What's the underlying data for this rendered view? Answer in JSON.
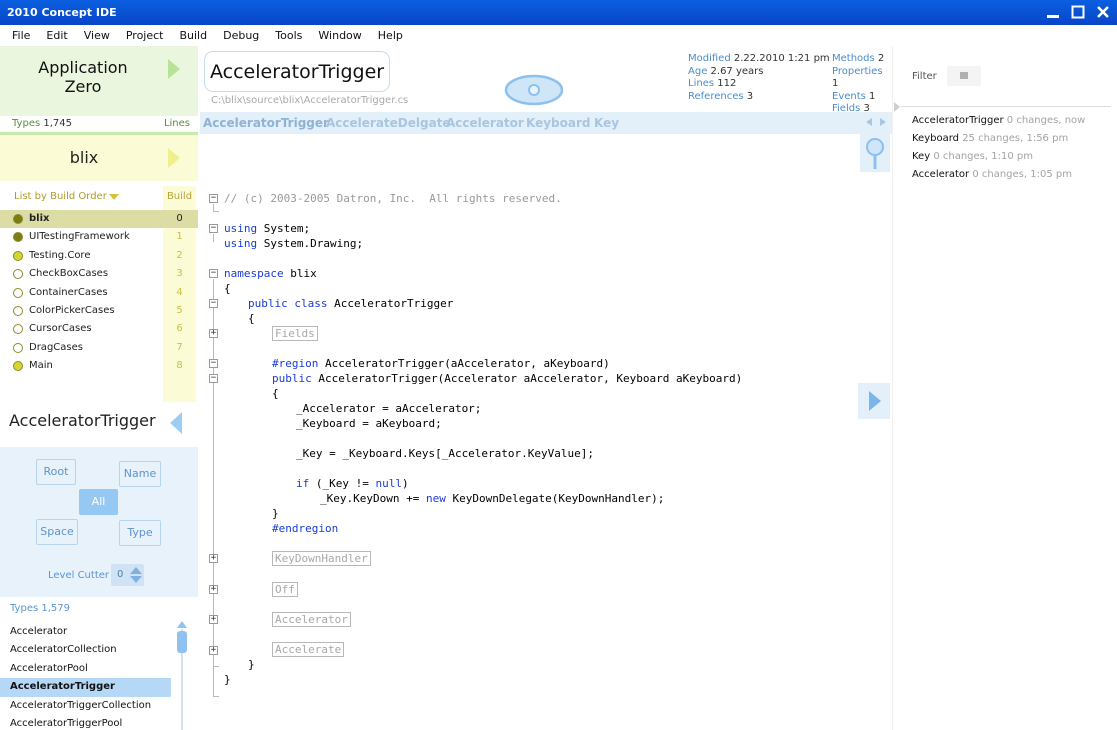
{
  "window": {
    "title": "2010 Concept IDE"
  },
  "menu": [
    "File",
    "Edit",
    "View",
    "Project",
    "Build",
    "Debug",
    "Tools",
    "Window",
    "Help"
  ],
  "solution": {
    "name_line1": "Application",
    "name_line2": "Zero",
    "types_label": "Types",
    "types_count": "1,745",
    "lines_label": "Lines"
  },
  "project": {
    "name": "blix",
    "list_label": "List by Build Order",
    "build_label": "Build",
    "items": [
      {
        "name": "blix",
        "build": "0"
      },
      {
        "name": "UITestingFramework",
        "build": "1"
      },
      {
        "name": "Testing.Core",
        "build": "2"
      },
      {
        "name": "CheckBoxCases",
        "build": "3"
      },
      {
        "name": "ContainerCases",
        "build": "4"
      },
      {
        "name": "ColorPickerCases",
        "build": "5"
      },
      {
        "name": "CursorCases",
        "build": "6"
      },
      {
        "name": "DragCases",
        "build": "7"
      },
      {
        "name": "Main",
        "build": "8"
      }
    ]
  },
  "type_nav": {
    "title": "AcceleratorTrigger",
    "buttons": {
      "root": "Root",
      "name": "Name",
      "all": "All",
      "space": "Space",
      "type": "Type"
    },
    "level_label": "Level Cutter",
    "level_value": "0",
    "types_label": "Types 1,579",
    "types": [
      "Accelerator",
      "AcceleratorCollection",
      "AcceleratorPool",
      "AcceleratorTrigger",
      "AcceleratorTriggerCollection",
      "AcceleratorTriggerPool"
    ]
  },
  "file": {
    "class_name": "AcceleratorTrigger",
    "path": "C:\\blix\\source\\blix\\AcceleratorTrigger.cs",
    "modified_label": "Modified",
    "modified_value": "2.22.2010 1:21 pm",
    "age_label": "Age",
    "age_value": "2.67 years",
    "lines_label": "Lines",
    "lines_value": "112",
    "references_label": "References",
    "references_value": "3",
    "methods_label": "Methods",
    "methods_value": "2",
    "properties_label": "Properties",
    "properties_value": "1",
    "events_label": "Events",
    "events_value": "1",
    "fields_label": "Fields",
    "fields_value": "3"
  },
  "breadcrumbs": [
    "AcceleratorTrigger",
    "AccelerateDelgate",
    "Accelerator",
    "Keyboard",
    "Key"
  ],
  "code": {
    "l1": "// (c) 2003-2005 Datron, Inc.  All rights reserved.",
    "using": "using",
    "system": " System;",
    "system_drawing": " System.Drawing;",
    "namespace_kw": "namespace",
    "namespace_name": " blix",
    "public_kw": "public",
    "class_kw": "class",
    "class_name": " AcceleratorTrigger",
    "fields_region": "Fields",
    "region_kw": "#region",
    "region_name": " AcceleratorTrigger(aAccelerator, aKeyboard)",
    "ctor_sig": " AcceleratorTrigger(Accelerator aAccelerator, Keyboard aKeyboard)",
    "assign1": "_Accelerator = aAccelerator;",
    "assign2": "_Keyboard = aKeyboard;",
    "assign3": "_Key = _Keyboard.Keys[_Accelerator.KeyValue];",
    "if_kw": "if",
    "if_cond": " (_Key != ",
    "null_kw": "null",
    "if_close": ")",
    "keydown_pre": "_Key.KeyDown += ",
    "new_kw": "new",
    "keydown_post": " KeyDownDelegate(KeyDownHandler);",
    "endregion": "#endregion",
    "collapsed": [
      "KeyDownHandler",
      "Off",
      "Accelerator",
      "Accelerate"
    ]
  },
  "history": {
    "filter_label": "Filter",
    "items": [
      {
        "name": "AcceleratorTrigger",
        "detail": " 0 changes, now"
      },
      {
        "name": "Keyboard",
        "detail": " 25 changes, 1:56 pm"
      },
      {
        "name": "Key",
        "detail": " 0 changes, 1:10 pm"
      },
      {
        "name": "Accelerator",
        "detail": " 0 changes, 1:05 pm"
      }
    ]
  },
  "colors": {
    "titlebar": "#0b5fe0",
    "keyword": "#1a3cd6",
    "accent_blue": "#96c8f4",
    "solution_green": "#eaf6de",
    "project_yellow": "#fbfbd6"
  }
}
